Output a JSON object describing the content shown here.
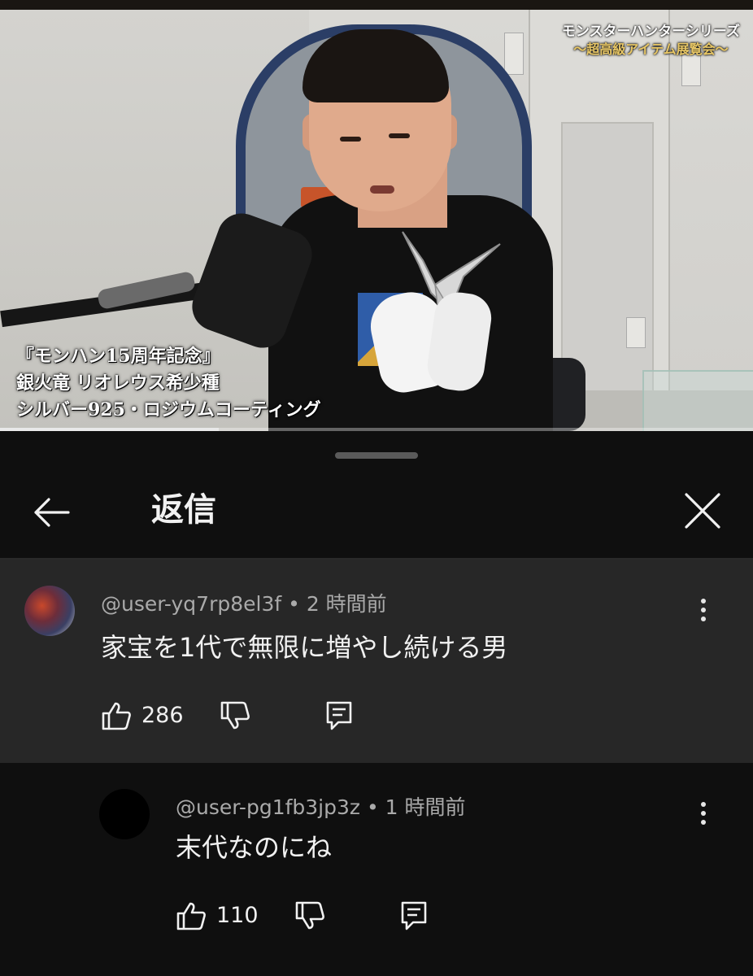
{
  "video": {
    "overlay_top_line1": "モンスターハンターシリーズ",
    "overlay_top_line2": "〜超高級アイテム展覧会〜",
    "overlay_caption_line1": "『モンハン15周年記念』",
    "overlay_caption_line2": "銀火竜 リオレウス希少種",
    "overlay_caption_line3": "シルバー925・ロジウムコーティング",
    "progress_fraction": 0.29
  },
  "sheet": {
    "title": "返信",
    "back_icon": "back-arrow-icon",
    "close_icon": "close-icon"
  },
  "comments": [
    {
      "author": "@user-yq7rp8el3f",
      "separator": " • ",
      "time": "2 時間前",
      "text": "家宝を1代で無限に増やし続ける男",
      "likes": "286"
    },
    {
      "author": "@user-pg1fb3jp3z",
      "separator": " • ",
      "time": "1 時間前",
      "text": "末代なのにね",
      "likes": "110"
    }
  ],
  "colors": {
    "background": "#0f0f0f",
    "highlighted_comment_bg": "#272727",
    "meta_text": "#aaaaaa",
    "primary_text": "#f1f1f1"
  }
}
